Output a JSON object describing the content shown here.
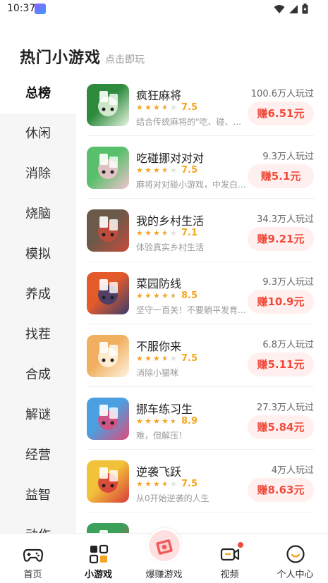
{
  "status_bar": {
    "time": "10:37"
  },
  "header": {
    "title": "热门小游戏",
    "subtitle": "点击即玩"
  },
  "sidebar": {
    "items": [
      {
        "label": "总榜"
      },
      {
        "label": "休闲"
      },
      {
        "label": "消除"
      },
      {
        "label": "烧脑"
      },
      {
        "label": "模拟"
      },
      {
        "label": "养成"
      },
      {
        "label": "找茬"
      },
      {
        "label": "合成"
      },
      {
        "label": "解谜"
      },
      {
        "label": "经营"
      },
      {
        "label": "益智"
      },
      {
        "label": "动作"
      }
    ]
  },
  "games": [
    {
      "name": "疯狂麻将",
      "score": "7.5",
      "stars": 3.5,
      "desc": "结合传统麻将的\"吃、碰、...",
      "players": "100.6万人玩过",
      "earn": "赚6.51元",
      "icon_colors": [
        "#2e8b3e",
        "#e9f5e1"
      ]
    },
    {
      "name": "吃碰挪对对对",
      "score": "7.5",
      "stars": 3.5,
      "desc": "麻将对对碰小游戏，中发白...",
      "players": "9.3万人玩过",
      "earn": "赚5.1元",
      "icon_colors": [
        "#58c06a",
        "#f3c2d0"
      ]
    },
    {
      "name": "我的乡村生活",
      "score": "7.1",
      "stars": 3.5,
      "desc": "体验真实乡村生活",
      "players": "34.3万人玩过",
      "earn": "赚9.21元",
      "icon_colors": [
        "#6b5a4a",
        "#c94a3a"
      ]
    },
    {
      "name": "菜园防线",
      "score": "8.5",
      "stars": 4.5,
      "desc": "坚守一百关！不要躺平发育...",
      "players": "9.3万人玩过",
      "earn": "赚10.9元",
      "icon_colors": [
        "#e35b2b",
        "#3c3c6e"
      ]
    },
    {
      "name": "不服你来",
      "score": "7.5",
      "stars": 3.5,
      "desc": "消除小猫咪",
      "players": "6.8万人玩过",
      "earn": "赚5.11元",
      "icon_colors": [
        "#f0b060",
        "#fff4e0"
      ]
    },
    {
      "name": "挪车练习生",
      "score": "8.9",
      "stars": 4.5,
      "desc": "难，但解压！",
      "players": "27.3万人玩过",
      "earn": "赚5.84元",
      "icon_colors": [
        "#4aa0e0",
        "#e04a7a"
      ]
    },
    {
      "name": "逆袭飞跃",
      "score": "7.5",
      "stars": 3.5,
      "desc": "从0开始逆袭的人生",
      "players": "4万人玩过",
      "earn": "赚8.63元",
      "icon_colors": [
        "#f2c23a",
        "#d83a3a"
      ]
    },
    {
      "name": "",
      "score": "",
      "stars": 0,
      "desc": "",
      "players": "",
      "earn": "",
      "icon_colors": [
        "#3aa05a",
        "#e04a4a"
      ]
    }
  ],
  "bottom_nav": [
    {
      "label": "首页",
      "icon": "gamepad-icon"
    },
    {
      "label": "小游戏",
      "icon": "grid-icon"
    },
    {
      "label": "爆赚游戏",
      "icon": "money-icon"
    },
    {
      "label": "视频",
      "icon": "video-icon"
    },
    {
      "label": "个人中心",
      "icon": "smile-icon"
    }
  ],
  "colors": {
    "accent": "#f04a3a",
    "star": "#f4a623",
    "earn_bg": "#fff0ef"
  }
}
